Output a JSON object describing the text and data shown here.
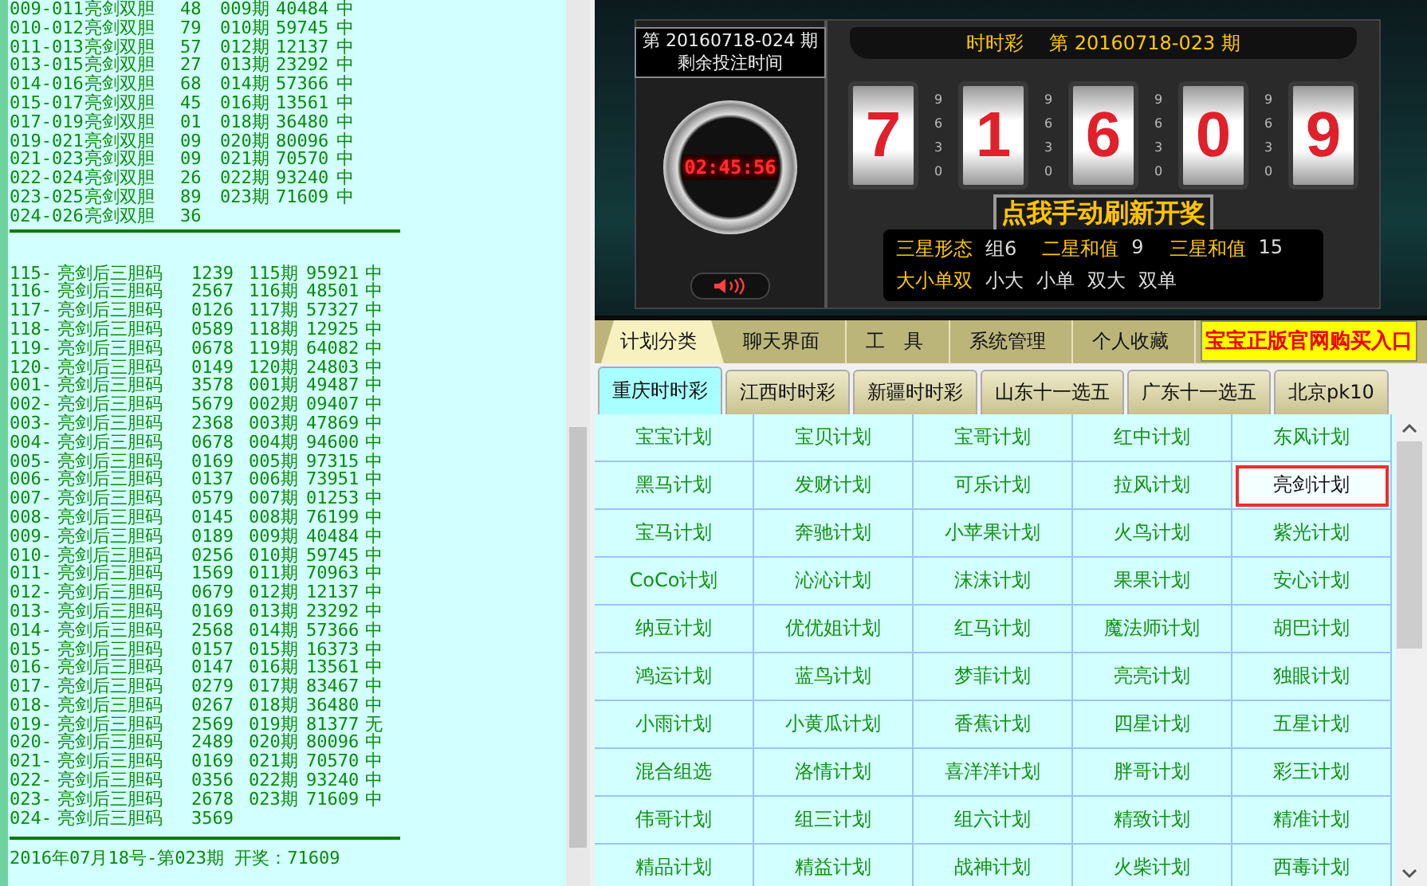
{
  "log": {
    "sections": [
      {
        "kind": "double",
        "lines": [
          {
            "id": "009-011",
            "plan": "亮剑双胆",
            "pick": "48",
            "issue": "009期",
            "draw": "40484",
            "result": "中"
          },
          {
            "id": "010-012",
            "plan": "亮剑双胆",
            "pick": "79",
            "issue": "010期",
            "draw": "59745",
            "result": "中"
          },
          {
            "id": "011-013",
            "plan": "亮剑双胆",
            "pick": "57",
            "issue": "012期",
            "draw": "12137",
            "result": "中"
          },
          {
            "id": "013-015",
            "plan": "亮剑双胆",
            "pick": "27",
            "issue": "013期",
            "draw": "23292",
            "result": "中"
          },
          {
            "id": "014-016",
            "plan": "亮剑双胆",
            "pick": "68",
            "issue": "014期",
            "draw": "57366",
            "result": "中"
          },
          {
            "id": "015-017",
            "plan": "亮剑双胆",
            "pick": "45",
            "issue": "016期",
            "draw": "13561",
            "result": "中"
          },
          {
            "id": "017-019",
            "plan": "亮剑双胆",
            "pick": "01",
            "issue": "018期",
            "draw": "36480",
            "result": "中"
          },
          {
            "id": "019-021",
            "plan": "亮剑双胆",
            "pick": "09",
            "issue": "020期",
            "draw": "80096",
            "result": "中"
          },
          {
            "id": "021-023",
            "plan": "亮剑双胆",
            "pick": "09",
            "issue": "021期",
            "draw": "70570",
            "result": "中"
          },
          {
            "id": "022-024",
            "plan": "亮剑双胆",
            "pick": "26",
            "issue": "022期",
            "draw": "93240",
            "result": "中"
          },
          {
            "id": "023-025",
            "plan": "亮剑双胆",
            "pick": "89",
            "issue": "023期",
            "draw": "71609",
            "result": "中"
          },
          {
            "id": "024-026",
            "plan": "亮剑双胆",
            "pick": "36"
          }
        ]
      },
      {
        "kind": "triple",
        "lines": [
          {
            "id": "115-",
            "plan": "亮剑后三胆码",
            "pick": "1239",
            "issue": "115期",
            "draw": "95921",
            "result": "中"
          },
          {
            "id": "116-",
            "plan": "亮剑后三胆码",
            "pick": "2567",
            "issue": "116期",
            "draw": "48501",
            "result": "中"
          },
          {
            "id": "117-",
            "plan": "亮剑后三胆码",
            "pick": "0126",
            "issue": "117期",
            "draw": "57327",
            "result": "中"
          },
          {
            "id": "118-",
            "plan": "亮剑后三胆码",
            "pick": "0589",
            "issue": "118期",
            "draw": "12925",
            "result": "中"
          },
          {
            "id": "119-",
            "plan": "亮剑后三胆码",
            "pick": "0678",
            "issue": "119期",
            "draw": "64082",
            "result": "中"
          },
          {
            "id": "120-",
            "plan": "亮剑后三胆码",
            "pick": "0149",
            "issue": "120期",
            "draw": "24803",
            "result": "中"
          },
          {
            "id": "001-",
            "plan": "亮剑后三胆码",
            "pick": "3578",
            "issue": "001期",
            "draw": "49487",
            "result": "中"
          },
          {
            "id": "002-",
            "plan": "亮剑后三胆码",
            "pick": "5679",
            "issue": "002期",
            "draw": "09407",
            "result": "中"
          },
          {
            "id": "003-",
            "plan": "亮剑后三胆码",
            "pick": "2368",
            "issue": "003期",
            "draw": "47869",
            "result": "中"
          },
          {
            "id": "004-",
            "plan": "亮剑后三胆码",
            "pick": "0678",
            "issue": "004期",
            "draw": "94600",
            "result": "中"
          },
          {
            "id": "005-",
            "plan": "亮剑后三胆码",
            "pick": "0169",
            "issue": "005期",
            "draw": "97315",
            "result": "中"
          },
          {
            "id": "006-",
            "plan": "亮剑后三胆码",
            "pick": "0137",
            "issue": "006期",
            "draw": "73951",
            "result": "中"
          },
          {
            "id": "007-",
            "plan": "亮剑后三胆码",
            "pick": "0579",
            "issue": "007期",
            "draw": "01253",
            "result": "中"
          },
          {
            "id": "008-",
            "plan": "亮剑后三胆码",
            "pick": "0145",
            "issue": "008期",
            "draw": "76199",
            "result": "中"
          },
          {
            "id": "009-",
            "plan": "亮剑后三胆码",
            "pick": "0189",
            "issue": "009期",
            "draw": "40484",
            "result": "中"
          },
          {
            "id": "010-",
            "plan": "亮剑后三胆码",
            "pick": "0256",
            "issue": "010期",
            "draw": "59745",
            "result": "中"
          },
          {
            "id": "011-",
            "plan": "亮剑后三胆码",
            "pick": "1569",
            "issue": "011期",
            "draw": "70963",
            "result": "中"
          },
          {
            "id": "012-",
            "plan": "亮剑后三胆码",
            "pick": "0679",
            "issue": "012期",
            "draw": "12137",
            "result": "中"
          },
          {
            "id": "013-",
            "plan": "亮剑后三胆码",
            "pick": "0169",
            "issue": "013期",
            "draw": "23292",
            "result": "中"
          },
          {
            "id": "014-",
            "plan": "亮剑后三胆码",
            "pick": "2568",
            "issue": "014期",
            "draw": "57366",
            "result": "中"
          },
          {
            "id": "015-",
            "plan": "亮剑后三胆码",
            "pick": "0157",
            "issue": "015期",
            "draw": "16373",
            "result": "中"
          },
          {
            "id": "016-",
            "plan": "亮剑后三胆码",
            "pick": "0147",
            "issue": "016期",
            "draw": "13561",
            "result": "中"
          },
          {
            "id": "017-",
            "plan": "亮剑后三胆码",
            "pick": "0279",
            "issue": "017期",
            "draw": "83467",
            "result": "中"
          },
          {
            "id": "018-",
            "plan": "亮剑后三胆码",
            "pick": "0267",
            "issue": "018期",
            "draw": "36480",
            "result": "中"
          },
          {
            "id": "019-",
            "plan": "亮剑后三胆码",
            "pick": "2569",
            "issue": "019期",
            "draw": "81377",
            "result": "无"
          },
          {
            "id": "020-",
            "plan": "亮剑后三胆码",
            "pick": "2489",
            "issue": "020期",
            "draw": "80096",
            "result": "中"
          },
          {
            "id": "021-",
            "plan": "亮剑后三胆码",
            "pick": "0169",
            "issue": "021期",
            "draw": "70570",
            "result": "中"
          },
          {
            "id": "022-",
            "plan": "亮剑后三胆码",
            "pick": "0356",
            "issue": "022期",
            "draw": "93240",
            "result": "中"
          },
          {
            "id": "023-",
            "plan": "亮剑后三胆码",
            "pick": "2678",
            "issue": "023期",
            "draw": "71609",
            "result": "中"
          },
          {
            "id": "024-",
            "plan": "亮剑后三胆码",
            "pick": "3569"
          }
        ]
      }
    ],
    "footer": "2016年07月18号-第023期 开奖：71609"
  },
  "draw_panel": {
    "next_issue": "第 20160718-024 期",
    "countdown_label": "剩余投注时间",
    "countdown": "02:45:56",
    "game": "时时彩",
    "last_issue": "第 20160718-023 期",
    "digits": [
      "7",
      "1",
      "6",
      "0",
      "9"
    ],
    "reel_scales": [
      [
        "9",
        "6",
        "3",
        "0"
      ],
      [
        "9",
        "6",
        "3",
        "0"
      ],
      [
        "9",
        "6",
        "3",
        "0"
      ],
      [
        "9",
        "6",
        "3",
        "0"
      ]
    ],
    "refresh_button": "点我手动刷新开奖",
    "stats": [
      {
        "label": "三星形态",
        "value": "组6"
      },
      {
        "label": "二星和值",
        "value": "9"
      },
      {
        "label": "三星和值",
        "value": "15"
      }
    ],
    "size_parity": {
      "label": "大小单双",
      "values": [
        "小大",
        "小单",
        "双大",
        "双单"
      ]
    }
  },
  "main_tabs": [
    {
      "label": "计划分类",
      "selected": true
    },
    {
      "label": "聊天界面",
      "selected": false
    },
    {
      "label": "工　具",
      "selected": false
    },
    {
      "label": "系统管理",
      "selected": false
    },
    {
      "label": "个人收藏",
      "selected": false
    }
  ],
  "buy_link": "宝宝正版官网购买入口",
  "lottery_tabs": [
    {
      "label": "重庆时时彩",
      "selected": true
    },
    {
      "label": "江西时时彩",
      "selected": false
    },
    {
      "label": "新疆时时彩",
      "selected": false
    },
    {
      "label": "山东十一选五",
      "selected": false
    },
    {
      "label": "广东十一选五",
      "selected": false
    },
    {
      "label": "北京pk10",
      "selected": false
    }
  ],
  "plans": [
    {
      "label": "宝宝计划",
      "selected": false
    },
    {
      "label": "宝贝计划",
      "selected": false
    },
    {
      "label": "宝哥计划",
      "selected": false
    },
    {
      "label": "红中计划",
      "selected": false
    },
    {
      "label": "东风计划",
      "selected": false
    },
    {
      "label": "黑马计划",
      "selected": false
    },
    {
      "label": "发财计划",
      "selected": false
    },
    {
      "label": "可乐计划",
      "selected": false
    },
    {
      "label": "拉风计划",
      "selected": false
    },
    {
      "label": "亮剑计划",
      "selected": true
    },
    {
      "label": "宝马计划",
      "selected": false
    },
    {
      "label": "奔驰计划",
      "selected": false
    },
    {
      "label": "小苹果计划",
      "selected": false
    },
    {
      "label": "火鸟计划",
      "selected": false
    },
    {
      "label": "紫光计划",
      "selected": false
    },
    {
      "label": "CoCo计划",
      "selected": false
    },
    {
      "label": "沁沁计划",
      "selected": false
    },
    {
      "label": "沫沫计划",
      "selected": false
    },
    {
      "label": "果果计划",
      "selected": false
    },
    {
      "label": "安心计划",
      "selected": false
    },
    {
      "label": "纳豆计划",
      "selected": false
    },
    {
      "label": "优优姐计划",
      "selected": false
    },
    {
      "label": "红马计划",
      "selected": false
    },
    {
      "label": "魔法师计划",
      "selected": false
    },
    {
      "label": "胡巴计划",
      "selected": false
    },
    {
      "label": "鸿运计划",
      "selected": false
    },
    {
      "label": "蓝鸟计划",
      "selected": false
    },
    {
      "label": "梦菲计划",
      "selected": false
    },
    {
      "label": "亮亮计划",
      "selected": false
    },
    {
      "label": "独眼计划",
      "selected": false
    },
    {
      "label": "小雨计划",
      "selected": false
    },
    {
      "label": "小黄瓜计划",
      "selected": false
    },
    {
      "label": "香蕉计划",
      "selected": false
    },
    {
      "label": "四星计划",
      "selected": false
    },
    {
      "label": "五星计划",
      "selected": false
    },
    {
      "label": "混合组选",
      "selected": false
    },
    {
      "label": "洛情计划",
      "selected": false
    },
    {
      "label": "喜洋洋计划",
      "selected": false
    },
    {
      "label": "胖哥计划",
      "selected": false
    },
    {
      "label": "彩王计划",
      "selected": false
    },
    {
      "label": "伟哥计划",
      "selected": false
    },
    {
      "label": "组三计划",
      "selected": false
    },
    {
      "label": "组六计划",
      "selected": false
    },
    {
      "label": "精致计划",
      "selected": false
    },
    {
      "label": "精准计划",
      "selected": false
    },
    {
      "label": "精品计划",
      "selected": false
    },
    {
      "label": "精益计划",
      "selected": false
    },
    {
      "label": "战神计划",
      "selected": false
    },
    {
      "label": "火柴计划",
      "selected": false
    },
    {
      "label": "西毒计划",
      "selected": false
    }
  ]
}
